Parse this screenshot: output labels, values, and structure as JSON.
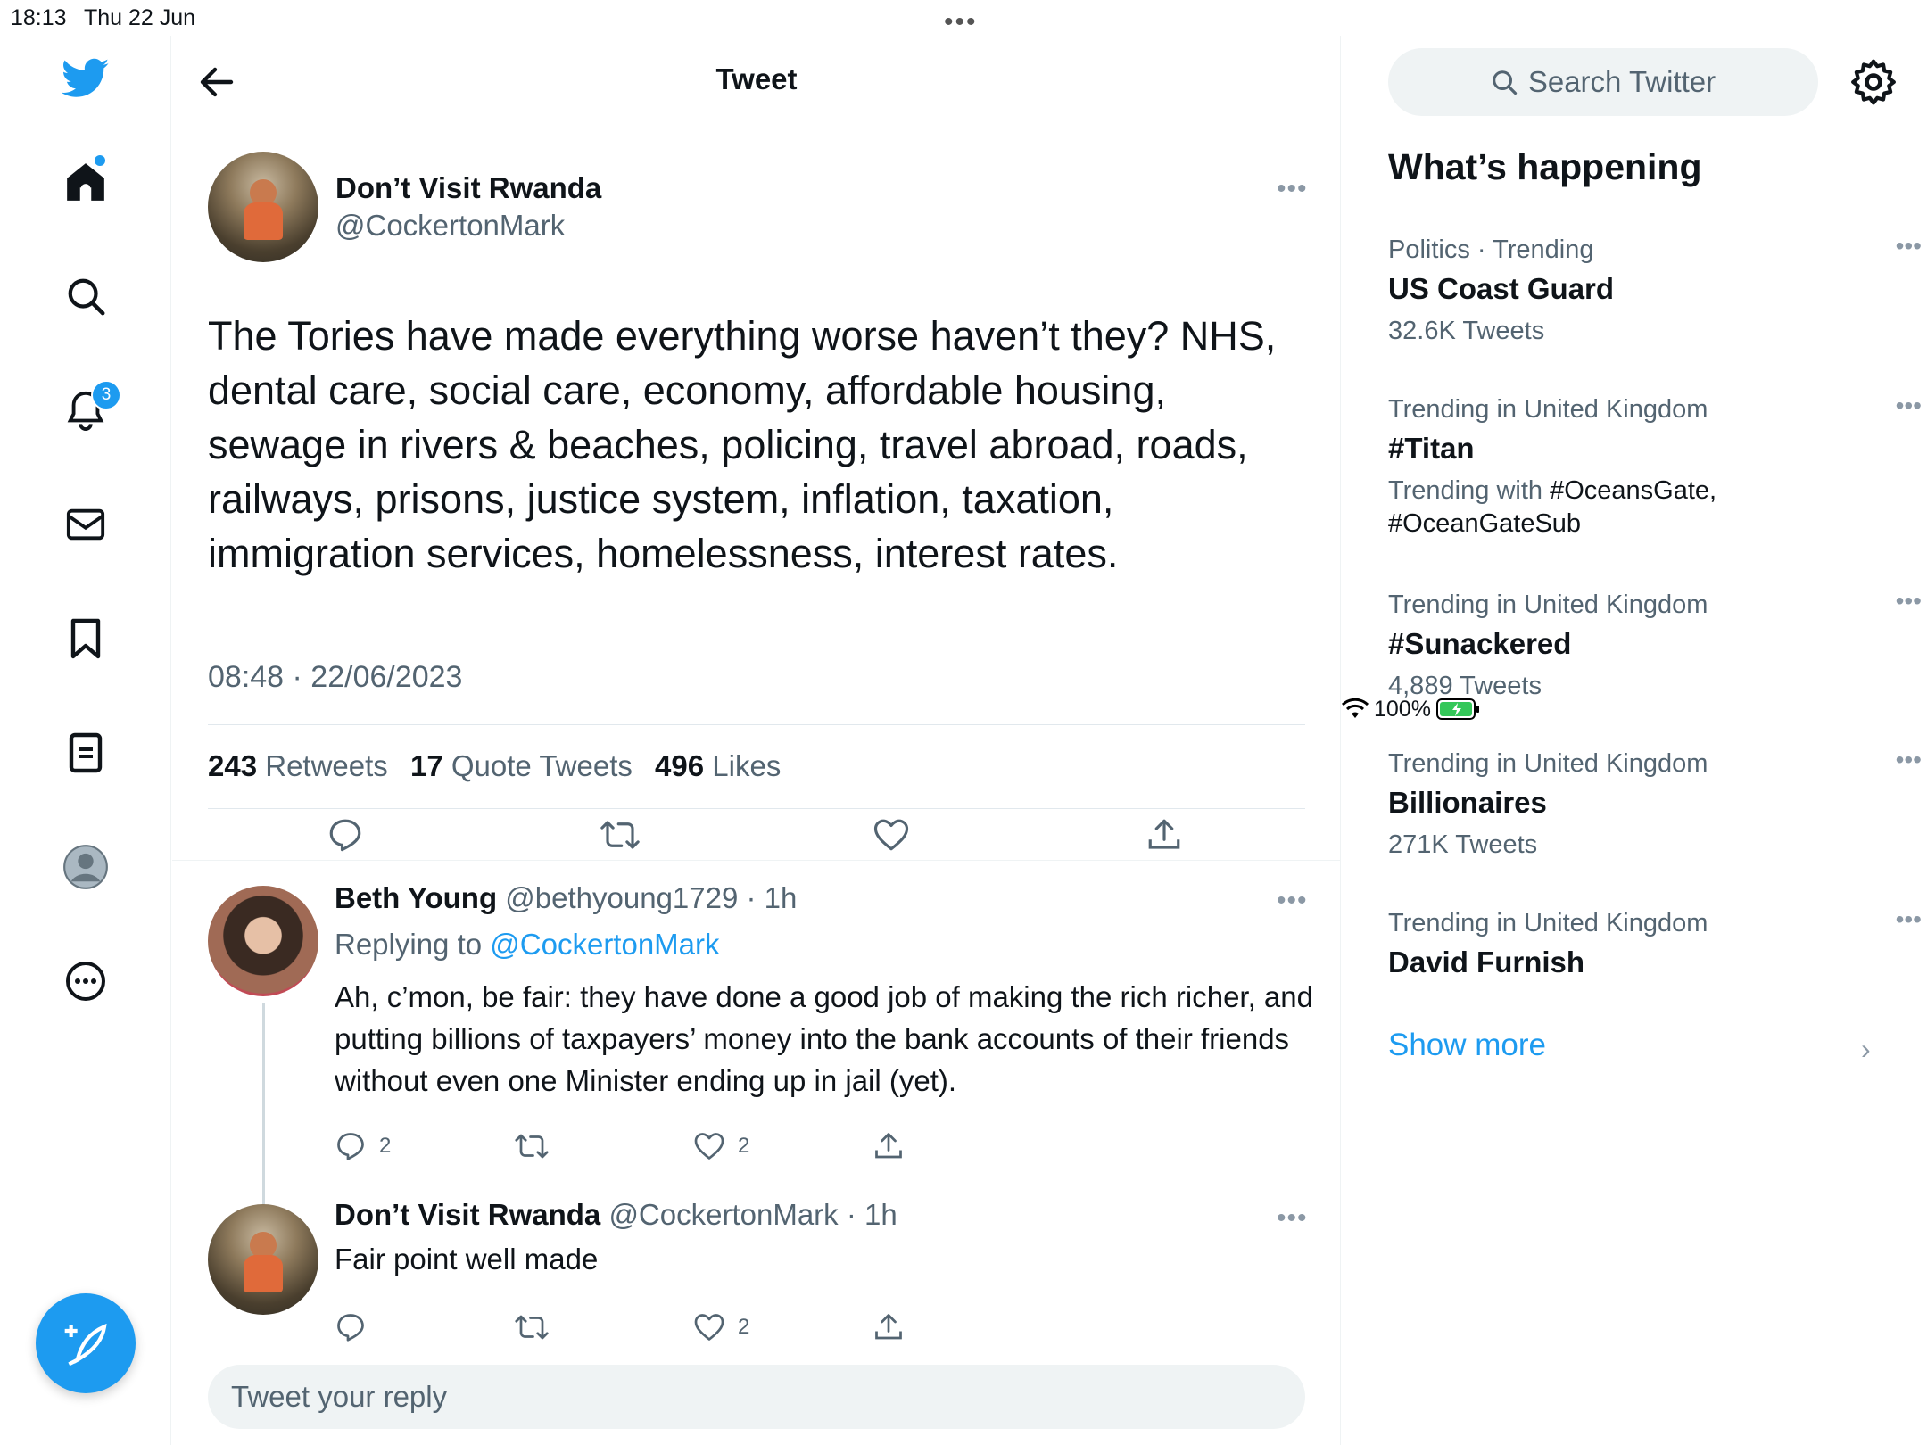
{
  "status_bar": {
    "time": "18:13",
    "date": "Thu 22 Jun",
    "battery": "100%"
  },
  "nav": {
    "notifications_badge": "3"
  },
  "header": {
    "title": "Tweet"
  },
  "tweet": {
    "name": "Don’t Visit Rwanda",
    "handle": "@CockertonMark",
    "text": "The Tories have made everything worse haven’t they? NHS, dental care, social care, economy, affordable housing, sewage in rivers & beaches, policing, travel abroad, roads, railways, prisons, justice system, inflation, taxation, immigration services, homelessness, interest rates.",
    "timestamp": "08:48 · 22/06/2023",
    "retweets_count": "243",
    "retweets_label": "Retweets",
    "quotes_count": "17",
    "quotes_label": "Quote Tweets",
    "likes_count": "496",
    "likes_label": "Likes"
  },
  "replies": [
    {
      "name": "Beth Young",
      "handle": "@bethyoung1729 · 1h",
      "replying_prefix": "Replying to",
      "replying_to": "@CockertonMark",
      "text": "Ah, c’mon, be fair: they have done a good job of making the rich richer, and putting billions of taxpayers’ money into the bank accounts of their friends without even one Minister ending up in jail (yet).",
      "reply_count": "2",
      "like_count": "2"
    },
    {
      "name": "Don’t Visit Rwanda",
      "handle": "@CockertonMark · 1h",
      "text": "Fair point well made",
      "like_count": "2"
    }
  ],
  "reply_box": {
    "placeholder": "Tweet your reply"
  },
  "sidebar": {
    "search_placeholder": "Search Twitter",
    "heading": "What’s happening",
    "trends": [
      {
        "context": "Politics · Trending",
        "title": "US Coast Guard",
        "sub": "32.6K Tweets"
      },
      {
        "context": "Trending in United Kingdom",
        "title": "#Titan",
        "sub_prefix": "Trending with",
        "sub_tags": "#OceansGate,",
        "sub_tags2": "#OceanGateSub"
      },
      {
        "context": "Trending in United Kingdom",
        "title": "#Sunackered",
        "sub": "4,889 Tweets"
      },
      {
        "context": "Trending in United Kingdom",
        "title": "Billionaires",
        "sub": "271K Tweets"
      },
      {
        "context": "Trending in United Kingdom",
        "title": "David Furnish"
      }
    ],
    "show_more": "Show more"
  },
  "colors": {
    "accent": "#1d9bf0",
    "text": "#0f1419",
    "secondary": "#536471"
  },
  "icons": [
    "twitter-logo-icon",
    "home-icon",
    "search-icon",
    "bell-icon",
    "mail-icon",
    "bookmark-icon",
    "list-icon",
    "profile-icon",
    "more-circle-icon",
    "compose-icon",
    "back-arrow-icon",
    "reply-icon",
    "retweet-icon",
    "like-icon",
    "share-icon",
    "gear-icon",
    "chevron-right-icon",
    "wifi-icon",
    "battery-icon"
  ]
}
